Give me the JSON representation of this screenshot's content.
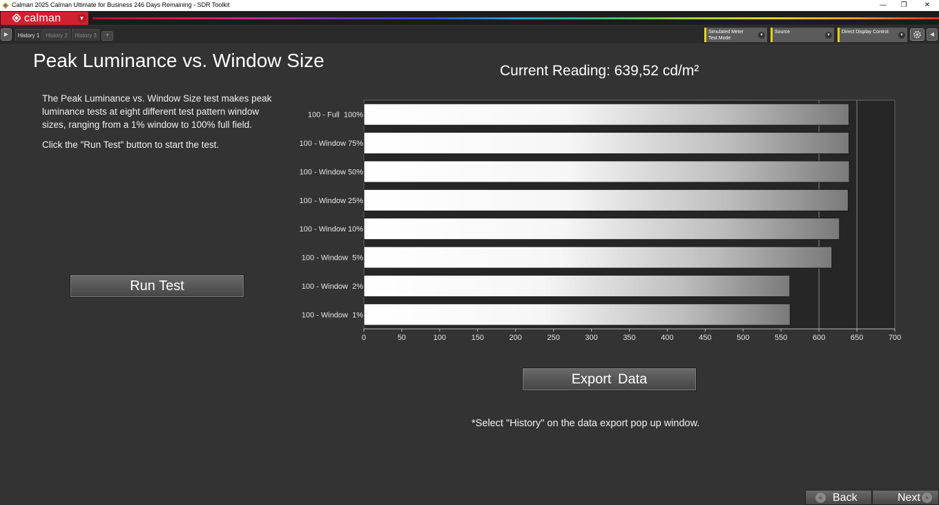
{
  "window": {
    "title": "Calman 2025 Calman Ultimate for Business 246 Days Remaining  - SDR Toolkit",
    "minimize_glyph": "—",
    "restore_glyph": "❐",
    "close_glyph": "✕"
  },
  "brand": {
    "logo_text": "calman",
    "caret": "▼"
  },
  "tabs": [
    {
      "label": "History 1",
      "active": true
    },
    {
      "label": "History 2",
      "active": false
    },
    {
      "label": "History 3",
      "active": false
    }
  ],
  "tab_add": "+",
  "dropdowns": {
    "meter": {
      "line1": "Simulated Meter",
      "line2": "Test Mode"
    },
    "source": {
      "line1": "Source"
    },
    "display": {
      "line1": "Direct Display Control"
    }
  },
  "page": {
    "title": "Peak Luminance vs. Window Size",
    "description": "The Peak Luminance vs. Window Size test makes peak luminance tests at eight different test pattern window sizes, ranging from a 1% window to 100% full field.",
    "instruction": "Click the \"Run Test\" button to start the test.",
    "current_reading": "Current Reading: 639,52 cd/m²",
    "run_test_label": "Run Test",
    "export_label": "Export  Data",
    "footnote": "*Select \"History\" on the data export pop up window."
  },
  "nav": {
    "back_label": "Back",
    "next_label": "Next"
  },
  "colors": {
    "accent_red": "#d1202f",
    "dropdown_marker": "#e6d31a",
    "background": "#333333"
  },
  "chart_data": {
    "type": "bar",
    "orientation": "horizontal",
    "categories": [
      "100 - Full  100%",
      "100 - Window 75%",
      "100 - Window 50%",
      "100 - Window 25%",
      "100 - Window 10%",
      "100 - Window  5%",
      "100 - Window  2%",
      "100 - Window  1%"
    ],
    "values": [
      639.5,
      639.5,
      640.0,
      638.5,
      627.0,
      617.0,
      561.5,
      562.0
    ],
    "xlim": [
      0,
      700
    ],
    "xticks": [
      0,
      50,
      100,
      150,
      200,
      250,
      300,
      350,
      400,
      450,
      500,
      550,
      600,
      650,
      700
    ],
    "grid_lines": [
      600,
      650
    ],
    "grid": true
  }
}
